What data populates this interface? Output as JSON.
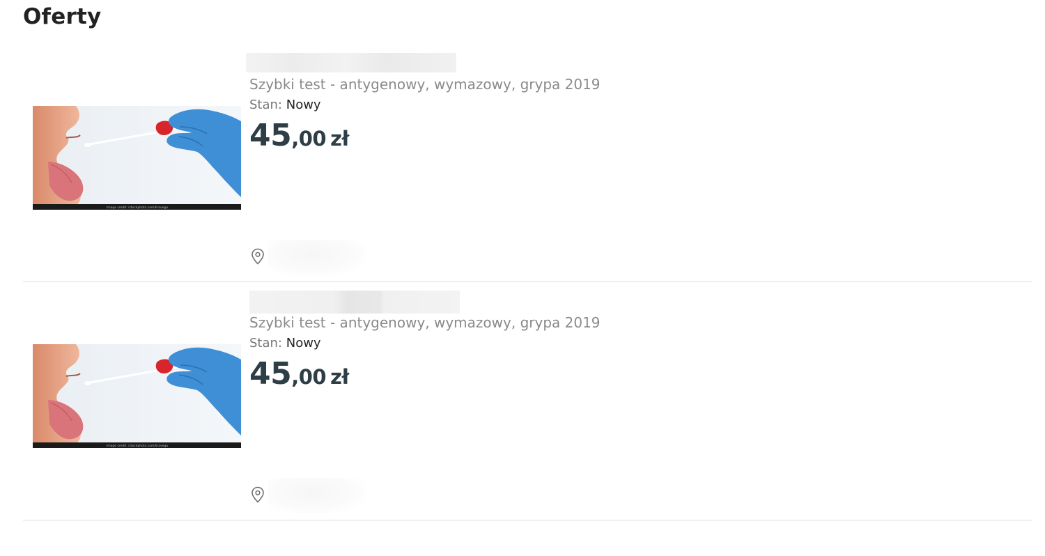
{
  "page": {
    "title": "Oferty"
  },
  "offers": [
    {
      "subtitle": "Szybki test - antygenowy, wymazowy, grypa 2019",
      "condition_label": "Stan:",
      "condition_value": "Nowy",
      "price_whole": "45",
      "price_fraction": ",00",
      "currency": "zł",
      "image_credit": "Image credit: istockphoto.com/liravega",
      "icon": "location-pin-icon"
    },
    {
      "subtitle": "Szybki test - antygenowy, wymazowy, grypa 2019",
      "condition_label": "Stan:",
      "condition_value": "Nowy",
      "price_whole": "45",
      "price_fraction": ",00",
      "currency": "zł",
      "image_credit": "Image credit: istockphoto.com/liravega",
      "icon": "location-pin-icon"
    }
  ],
  "colors": {
    "price": "#2d3e46",
    "subtitle": "#8a8a8a",
    "divider": "#dcdcdc",
    "glove": "#3f8fd6",
    "swab_tip": "#d8252c"
  }
}
